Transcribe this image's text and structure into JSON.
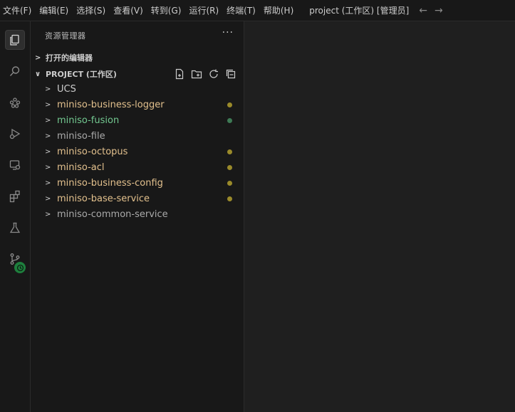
{
  "menu": [
    "文件(F)",
    "编辑(E)",
    "选择(S)",
    "查看(V)",
    "转到(G)",
    "运行(R)",
    "终端(T)",
    "帮助(H)"
  ],
  "window_title": "project (工作区) [管理员]",
  "explorer": {
    "title": "资源管理器",
    "open_editors": "打开的编辑器",
    "workspace": "PROJECT (工作区)",
    "items": [
      {
        "name": "UCS",
        "color": "#cccccc",
        "dot": ""
      },
      {
        "name": "miniso-business-logger",
        "color": "#e2c08d",
        "dot": "#9a8a2a"
      },
      {
        "name": "miniso-fusion",
        "color": "#73c991",
        "dot": "#3e7a55"
      },
      {
        "name": "miniso-file",
        "color": "#aaaaaa",
        "dot": ""
      },
      {
        "name": "miniso-octopus",
        "color": "#e2c08d",
        "dot": "#9a8a2a"
      },
      {
        "name": "miniso-acl",
        "color": "#e2c08d",
        "dot": "#9a8a2a"
      },
      {
        "name": "miniso-business-config",
        "color": "#e2c08d",
        "dot": "#9a8a2a"
      },
      {
        "name": "miniso-base-service",
        "color": "#e2c08d",
        "dot": "#9a8a2a"
      },
      {
        "name": "miniso-common-service",
        "color": "#aaaaaa",
        "dot": ""
      }
    ]
  },
  "icons": {
    "activity": [
      "files-icon",
      "search-icon",
      "extensions-debug-icon",
      "run-debug-icon",
      "remote-explorer-icon",
      "extensions-icon",
      "testing-icon",
      "source-control-icon"
    ],
    "toolbar": [
      "new-file-icon",
      "new-folder-icon",
      "refresh-icon",
      "collapse-all-icon"
    ]
  }
}
